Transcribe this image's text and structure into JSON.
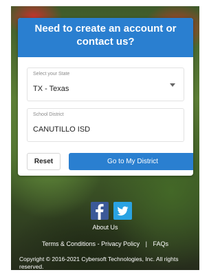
{
  "card": {
    "heading": "Need to create an account or contact us?"
  },
  "state_select": {
    "label": "Select your State",
    "value": "TX - Texas"
  },
  "district_field": {
    "label": "School District",
    "value": "CANUTILLO ISD"
  },
  "buttons": {
    "reset": "Reset",
    "go": "Go to My District"
  },
  "social": {
    "facebook_icon": "facebook-icon",
    "twitter_icon": "twitter-icon"
  },
  "footer": {
    "about": "About Us",
    "terms": "Terms & Conditions",
    "dash": "-",
    "privacy": "Privacy Policy",
    "divider": "|",
    "faqs": "FAQs",
    "copyright": "Copyright © 2016-2021 Cybersoft Technologies, Inc. All rights reserved."
  },
  "colors": {
    "accent": "#2a7fd0",
    "facebook": "#3b5998",
    "twitter": "#2aa3e3"
  }
}
